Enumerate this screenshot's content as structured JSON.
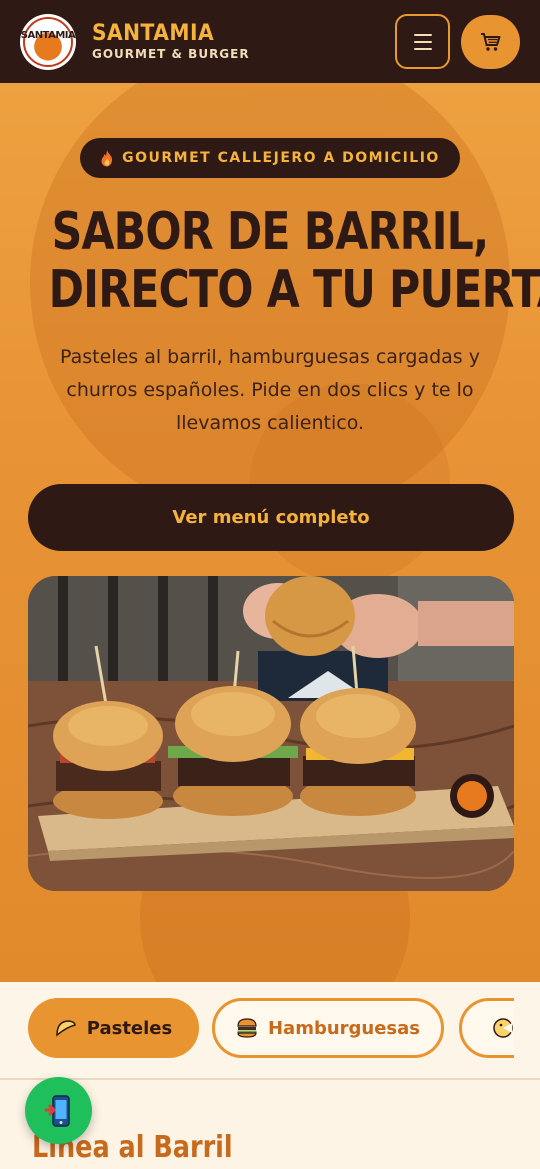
{
  "header": {
    "brand_name": "SANTAMIA",
    "brand_sub": "GOURMET & BURGER",
    "logo_text": "SANTAMIA",
    "menu_icon": "hamburger-menu-icon",
    "cart_icon": "cart-icon"
  },
  "hero": {
    "pill_icon": "fire-icon",
    "pill_text": "GOURMET CALLEJERO A DOMICILIO",
    "headline_line1": "SABOR DE BARRIL,",
    "headline_line2": "DIRECTO A TU PUERTA",
    "lead": "Pasteles al barril, hamburguesas cargadas y churros españoles. Pide en dos clics y te lo llevamos calientico.",
    "cta_label": "Ver menú completo",
    "photo_label": "burgers-and-pastel-photo"
  },
  "tabs": [
    {
      "label": "Pasteles",
      "icon": "pastel-icon",
      "active": true
    },
    {
      "label": "Hamburguesas",
      "icon": "burger-icon",
      "active": false
    },
    {
      "label": "",
      "icon": "churro-icon",
      "active": false
    }
  ],
  "section": {
    "title": "Línea al Barril"
  },
  "fab": {
    "icon": "phone-icon"
  },
  "colors": {
    "dark": "#2f1915",
    "accent": "#e89431",
    "gold": "#f6b33c",
    "green": "#1fbf5b"
  }
}
